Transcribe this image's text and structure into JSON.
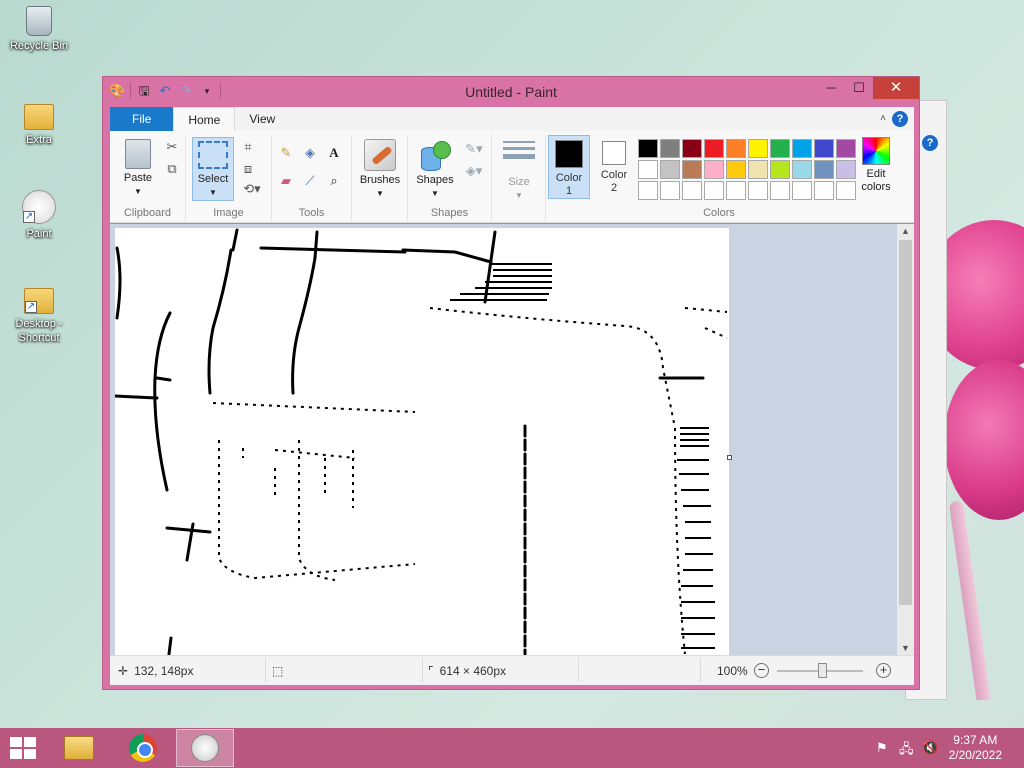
{
  "desktop": {
    "icons": [
      {
        "label": "Recycle Bin"
      },
      {
        "label": "Extra"
      },
      {
        "label": "Paint"
      },
      {
        "label": "Desktop - Shortcut"
      }
    ]
  },
  "window": {
    "title": "Untitled - Paint",
    "controls": {
      "minimize": "─",
      "maximize": "☐",
      "close": "✕"
    }
  },
  "tabs": [
    {
      "label": "File"
    },
    {
      "label": "Home"
    },
    {
      "label": "View"
    }
  ],
  "ribbon": {
    "groups": {
      "clipboard": "Clipboard",
      "image": "Image",
      "tools": "Tools",
      "shapes": "Shapes",
      "colors": "Colors"
    },
    "paste_label": "Paste",
    "select_label": "Select",
    "brushes_label": "Brushes",
    "shapes_label": "Shapes",
    "size_label": "Size",
    "color1_label": "Color\n1",
    "color1_l1": "Color",
    "color1_l2": "1",
    "color2_l1": "Color",
    "color2_l2": "2",
    "edit_colors_l1": "Edit",
    "edit_colors_l2": "colors",
    "color1_value": "#000000",
    "color2_value": "#ffffff",
    "palette": [
      "#000000",
      "#7f7f7f",
      "#880015",
      "#ed1c24",
      "#ff7f27",
      "#fff200",
      "#22b14c",
      "#00a2e8",
      "#3f48cc",
      "#a349a4",
      "#ffffff",
      "#c3c3c3",
      "#b97a57",
      "#ffaec9",
      "#ffc90e",
      "#efe4b0",
      "#b5e61d",
      "#99d9ea",
      "#7092be",
      "#c8bfe7",
      "#ffffff",
      "#ffffff",
      "#ffffff",
      "#ffffff",
      "#ffffff",
      "#ffffff",
      "#ffffff",
      "#ffffff",
      "#ffffff",
      "#ffffff"
    ]
  },
  "statusbar": {
    "cursor_pos": "132, 148px",
    "image_size": "614 × 460px",
    "zoom": "100%"
  },
  "taskbar": {
    "time": "9:37 AM",
    "date": "2/20/2022"
  }
}
